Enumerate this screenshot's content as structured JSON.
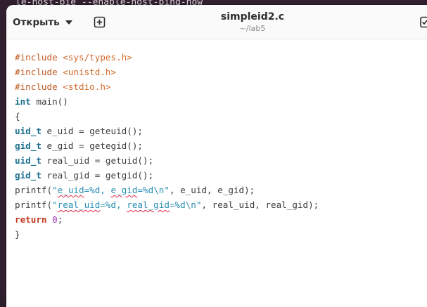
{
  "background": {
    "terminal_text": "le-host-pie --enable-host-bind-now"
  },
  "header": {
    "open_label": "Открыть",
    "title": "simpleid2.c",
    "subtitle": "~/lab5"
  },
  "editor": {
    "lines": [
      {
        "parts": [
          {
            "t": "#include ",
            "c": "pp"
          },
          {
            "t": "<sys/types.h>",
            "c": "inc"
          }
        ]
      },
      {
        "parts": [
          {
            "t": "#include ",
            "c": "pp"
          },
          {
            "t": "<unistd.h>",
            "c": "inc"
          }
        ]
      },
      {
        "parts": [
          {
            "t": "#include ",
            "c": "pp"
          },
          {
            "t": "<stdio.h>",
            "c": "inc"
          }
        ]
      },
      {
        "parts": [
          {
            "t": "int",
            "c": "kw"
          },
          {
            "t": " main()",
            "c": "plain"
          }
        ]
      },
      {
        "parts": [
          {
            "t": "{",
            "c": "plain"
          }
        ]
      },
      {
        "parts": [
          {
            "t": "uid_t",
            "c": "ty"
          },
          {
            "t": " e_uid = geteuid();",
            "c": "plain"
          }
        ]
      },
      {
        "parts": [
          {
            "t": "gid_t",
            "c": "ty"
          },
          {
            "t": " e_gid = getegid();",
            "c": "plain"
          }
        ]
      },
      {
        "parts": [
          {
            "t": "uid_t",
            "c": "ty"
          },
          {
            "t": " real_uid = getuid();",
            "c": "plain"
          }
        ]
      },
      {
        "parts": [
          {
            "t": "gid_t",
            "c": "ty"
          },
          {
            "t": " real_gid = getgid();",
            "c": "plain"
          }
        ]
      },
      {
        "parts": [
          {
            "t": "printf(",
            "c": "plain"
          },
          {
            "t": "\"",
            "c": "str"
          },
          {
            "t": "e_uid",
            "c": "str spell"
          },
          {
            "t": "=%d, ",
            "c": "str"
          },
          {
            "t": "e_gid",
            "c": "str spell"
          },
          {
            "t": "=%d",
            "c": "str"
          },
          {
            "t": "\\n",
            "c": "esc"
          },
          {
            "t": "\"",
            "c": "str"
          },
          {
            "t": ", e_uid, e_gid);",
            "c": "plain"
          }
        ]
      },
      {
        "parts": [
          {
            "t": "printf(",
            "c": "plain"
          },
          {
            "t": "\"",
            "c": "str"
          },
          {
            "t": "real_uid",
            "c": "str spell"
          },
          {
            "t": "=%d, ",
            "c": "str"
          },
          {
            "t": "real_gid",
            "c": "str spell"
          },
          {
            "t": "=%d",
            "c": "str"
          },
          {
            "t": "\\n",
            "c": "esc"
          },
          {
            "t": "\"",
            "c": "str"
          },
          {
            "t": ", real_uid, real_gid);",
            "c": "plain"
          }
        ]
      },
      {
        "parts": [
          {
            "t": "return",
            "c": "ret"
          },
          {
            "t": " ",
            "c": "plain"
          },
          {
            "t": "0",
            "c": "num"
          },
          {
            "t": ";",
            "c": "plain"
          }
        ]
      },
      {
        "parts": [
          {
            "t": "}",
            "c": "plain"
          }
        ]
      }
    ]
  },
  "icons": {
    "open_dropdown": "chevron-down-icon",
    "new_tab": "add-document-icon",
    "right_partial": "save-icon"
  },
  "colors": {
    "preprocessor": "#c05a22",
    "include_path": "#d26a2a",
    "keyword": "#1b6f8f",
    "return_keyword": "#c0391f",
    "number": "#9c36b5",
    "string": "#2a8fb5",
    "spellcheck": "#e0294a"
  }
}
